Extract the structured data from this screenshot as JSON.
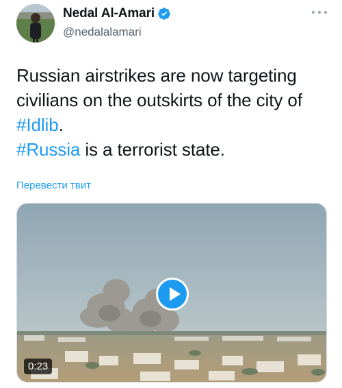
{
  "author": {
    "display_name": "Nedal Al-Amari",
    "handle": "@nedalalamari",
    "verified_icon": "verified-badge-icon"
  },
  "tweet": {
    "lines": [
      {
        "text": "Russian airstrikes are now targeting"
      },
      {
        "text": "civilians on the outskirts of the city of"
      },
      {
        "hashtag": "#Idlib",
        "after": "."
      },
      {
        "hashtag": "#Russia",
        "after": " is a terrorist state.",
        "before": " "
      }
    ]
  },
  "translate_label": "Перевести твит",
  "video": {
    "duration": "0:23",
    "play_icon": "play-icon"
  },
  "colors": {
    "accent": "#1d9bf0",
    "text": "#0f1419",
    "muted": "#536471"
  }
}
